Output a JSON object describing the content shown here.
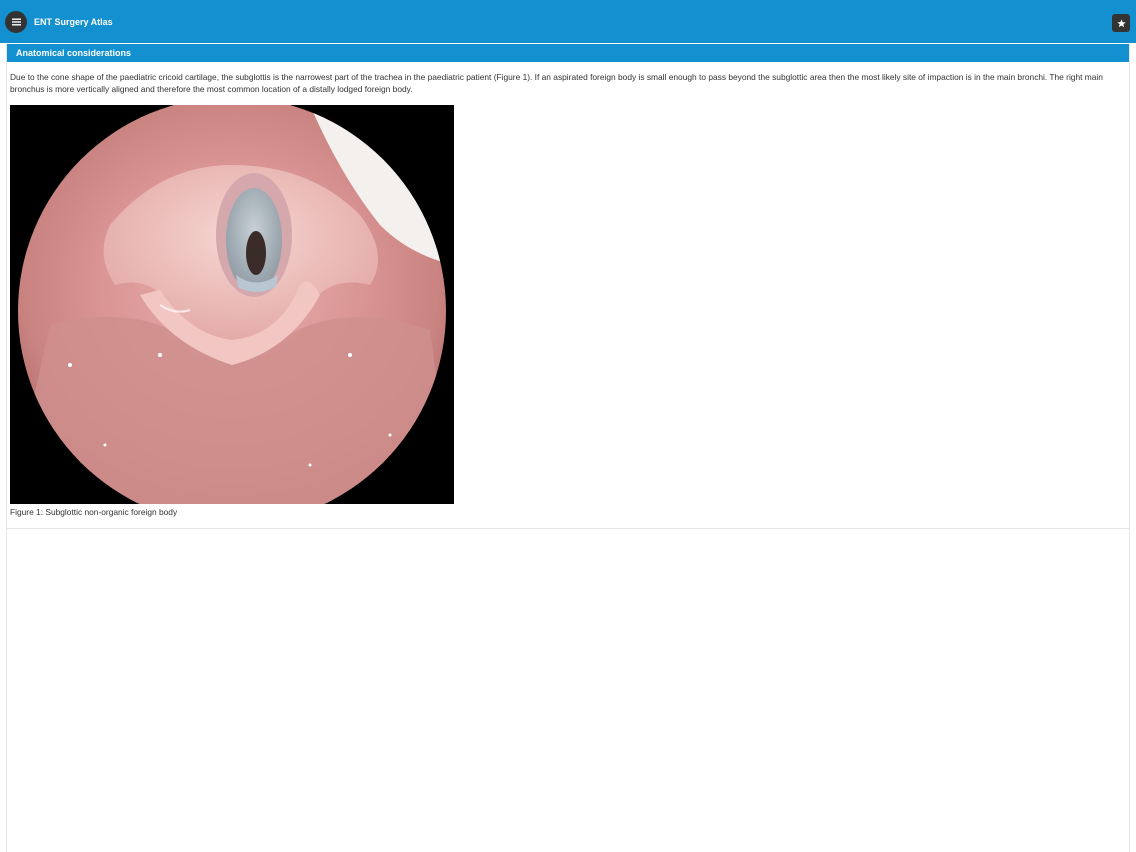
{
  "app": {
    "title": "ENT Surgery Atlas",
    "accent_color": "#1390d0",
    "menu_icon": "hamburger-menu-icon",
    "favorite_icon": "star-icon"
  },
  "section": {
    "title": "Anatomical considerations",
    "body": "Due to the cone shape of the paediatric cricoid cartilage, the subglottis is the narrowest part of the trachea in the paediatric patient (Figure 1). If an aspirated foreign body is small enough to pass beyond the subglottic area then the most likely site of impaction is in the main bronchi. The right main bronchus is more vertically aligned and therefore the most common location of a distally lodged foreign body.",
    "figure": {
      "caption": "Figure 1: Subglottic non-organic foreign body"
    }
  }
}
